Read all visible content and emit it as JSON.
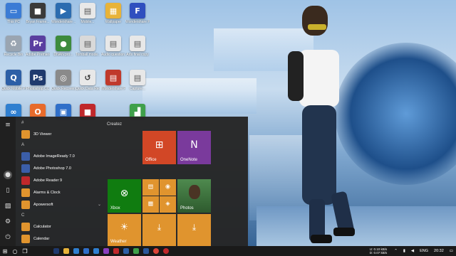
{
  "desktop": {
    "icons": [
      {
        "label": "This PC",
        "color": "#3a7bd5",
        "glyph": "▭"
      },
      {
        "label": "Bryan Frame...",
        "color": "#3a3a3a",
        "glyph": "■"
      },
      {
        "label": "Wondershare ...",
        "color": "#2b6cb0",
        "glyph": "▶"
      },
      {
        "label": "Mobile...",
        "color": "#e8e8e8",
        "glyph": "▤"
      },
      {
        "label": "Wallpaper",
        "color": "#e8b339",
        "glyph": "▦"
      },
      {
        "label": "Wondershare PDF element",
        "color": "#2f4fbf",
        "glyph": "F"
      },
      {
        "label": "Recycle Bin",
        "color": "#9aa5b1",
        "glyph": "♻"
      },
      {
        "label": "Adobe Premiere...",
        "color": "#5a3fa0",
        "glyph": "Pr"
      },
      {
        "label": "DNAN pro...",
        "color": "#3d8b3d",
        "glyph": "●"
      },
      {
        "label": "Tomball mode...",
        "color": "#d9d9d9",
        "glyph": "▤"
      },
      {
        "label": "Audio question...",
        "color": "#e8e8e8",
        "glyph": "▤"
      },
      {
        "label": "Arts final copy",
        "color": "#e8e8e8",
        "glyph": "▤"
      },
      {
        "label": "Quick Mobile Publisher",
        "color": "#2d5fa6",
        "glyph": "Q"
      },
      {
        "label": "Photoshop CC",
        "color": "#1f3a6e",
        "glyph": "Ps"
      },
      {
        "label": "Quick Recovery",
        "color": "#8a8a8a",
        "glyph": "◎"
      },
      {
        "label": "Quick Data Recovery",
        "color": "#e8e8e8",
        "glyph": "↺"
      },
      {
        "label": "Wondershare PDF Split...",
        "color": "#c0392b",
        "glyph": "▤"
      },
      {
        "label": "Capture...",
        "color": "#e8e8e8",
        "glyph": "▤"
      },
      {
        "label": "",
        "color": "#2f7fd0",
        "glyph": "∞"
      },
      {
        "label": "",
        "color": "#e86b2b",
        "glyph": "O"
      },
      {
        "label": "",
        "color": "#2f6fc9",
        "glyph": "▣"
      },
      {
        "label": "",
        "color": "#c0282b",
        "glyph": "■"
      },
      {
        "label": "",
        "color": "#3fa04a",
        "glyph": "▟"
      }
    ]
  },
  "start_menu": {
    "tiles_heading": "Createz",
    "groups": [
      {
        "header": "#",
        "apps": [
          {
            "label": "3D Viewer",
            "color": "#e0942e",
            "chev": ""
          }
        ]
      },
      {
        "header": "A",
        "apps": [
          {
            "label": "Adobe ImageReady 7.0",
            "color": "#3b5ea8",
            "chev": ""
          },
          {
            "label": "Adobe Photoshop 7.0",
            "color": "#3b5ea8",
            "chev": ""
          },
          {
            "label": "Adobe Reader 9",
            "color": "#c0282b",
            "chev": ""
          },
          {
            "label": "Alarms & Clock",
            "color": "#e0942e",
            "chev": ""
          },
          {
            "label": "Apowersoft",
            "color": "#e0942e",
            "chev": "⌄"
          }
        ]
      },
      {
        "header": "C",
        "apps": [
          {
            "label": "Calculator",
            "color": "#e0942e",
            "chev": ""
          },
          {
            "label": "Calendar",
            "color": "#e0942e",
            "chev": ""
          }
        ]
      }
    ],
    "tiles": [
      {
        "label": "Office",
        "color": "#d24726",
        "icon": "⊞"
      },
      {
        "label": "OneNote",
        "color": "#7a3a9c",
        "icon": "N"
      },
      {
        "label": "Xbox",
        "color": "#107c10",
        "icon": "⊗"
      },
      {
        "label": "",
        "color": "#e0942e",
        "icon": "▤"
      },
      {
        "label": "",
        "color": "#e0942e",
        "icon": "◉"
      },
      {
        "label": "",
        "color": "#e0942e",
        "icon": "▦"
      },
      {
        "label": "",
        "color": "#e0942e",
        "icon": "◈"
      },
      {
        "label": "Photos",
        "color": "#3c6e3c",
        "icon": ""
      },
      {
        "label": "Weather",
        "color": "#e0942e",
        "icon": "☀"
      },
      {
        "label": "",
        "color": "#e0942e",
        "icon": "⤓"
      },
      {
        "label": "",
        "color": "#e0942e",
        "icon": "⤓"
      }
    ]
  },
  "taskbar": {
    "apps": [
      {
        "name": "app-photoshop",
        "color": "#1f3a6e"
      },
      {
        "name": "app-file-explorer",
        "color": "#e8b339"
      },
      {
        "name": "app-edge",
        "color": "#2f7fd0"
      },
      {
        "name": "app-store",
        "color": "#2f6fc9"
      },
      {
        "name": "app-mail",
        "color": "#2f7fd0"
      },
      {
        "name": "app-media",
        "color": "#8a3fbf"
      },
      {
        "name": "app-red",
        "color": "#c0282b"
      },
      {
        "name": "app-blue",
        "color": "#2d5fa6"
      },
      {
        "name": "app-green",
        "color": "#3fa04a"
      },
      {
        "name": "app-word",
        "color": "#2b579a"
      },
      {
        "name": "app-chrome",
        "color": "#db4437"
      },
      {
        "name": "app-opera",
        "color": "#c0282b"
      }
    ],
    "net_up": "U: 0.10 kB/s",
    "net_down": "D: 0.07 kB/s",
    "language": "ENG",
    "time": "20:32"
  }
}
